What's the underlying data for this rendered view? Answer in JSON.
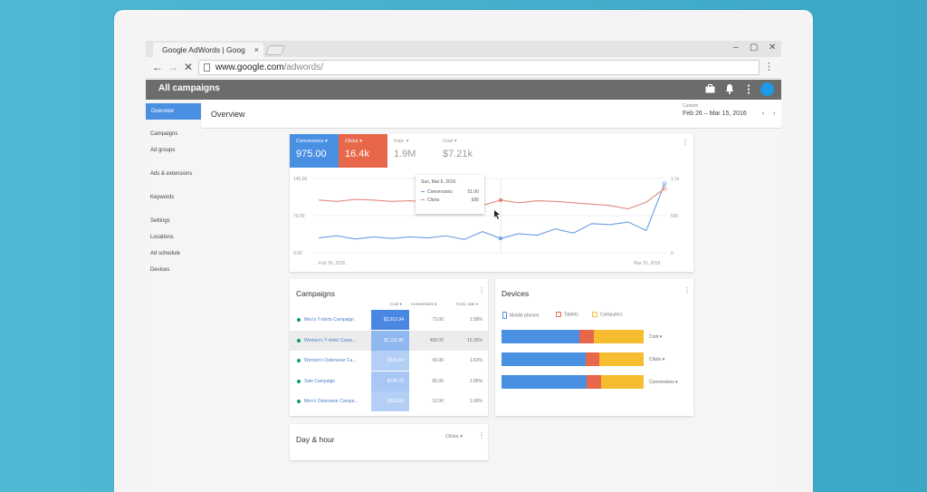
{
  "browser": {
    "tab_title": "Google AdWords | Goog",
    "tab_close": "×",
    "window_controls": [
      "–",
      "▢",
      "✕"
    ],
    "nav": {
      "back": "←",
      "forward": "→",
      "stop": "✕"
    },
    "url_host": "www.google.com",
    "url_path": "/adwords/",
    "menu": "⋮"
  },
  "appbar": {
    "title": "All campaigns",
    "icons": [
      "briefcase-icon",
      "bell-icon",
      "more-vert-icon",
      "avatar"
    ]
  },
  "sidebar": {
    "active": "Overview",
    "items": [
      "Campaigns",
      "Ad groups",
      "Ads & extensions",
      "Keywords",
      "Settings",
      "Locations",
      "Ad schedule",
      "Devices"
    ]
  },
  "overview": {
    "title": "Overview",
    "date_label": "Custom",
    "date_range": "Feb 26 – Mar 15, 2016",
    "prev": "‹",
    "next": "›"
  },
  "metrics": [
    {
      "label": "Conversions ▾",
      "value": "975.00",
      "color": "#4a90e2"
    },
    {
      "label": "Clicks ▾",
      "value": "16.4k",
      "color": "#e8674a"
    },
    {
      "label": "Impr. ▾",
      "value": "1.9M",
      "color": "#ffffff"
    },
    {
      "label": "Cost ▾",
      "value": "$7.21k",
      "color": "#ffffff"
    }
  ],
  "card_menu": "⋮",
  "chart_data": {
    "type": "line",
    "x_start_label": "Feb 26, 2016",
    "x_end_label": "Mar 15, 2016",
    "y_left_ticks": [
      "140.00",
      "70.00",
      "0.00"
    ],
    "y_right_ticks": [
      "1.1k",
      "550",
      "0"
    ],
    "ylim_left": [
      0,
      140
    ],
    "ylim_right": [
      0,
      1100
    ],
    "series": [
      {
        "name": "Conversions",
        "axis": "left",
        "color": "#6a9de0",
        "values": [
          28,
          32,
          26,
          30,
          27,
          30,
          28,
          32,
          25,
          40,
          27,
          36,
          33,
          45,
          37,
          55,
          53,
          58,
          42,
          130
        ]
      },
      {
        "name": "Clicks",
        "axis": "right",
        "color": "#e08b7e",
        "values": [
          780,
          760,
          790,
          780,
          760,
          770,
          750,
          760,
          850,
          700,
          780,
          740,
          770,
          760,
          740,
          720,
          700,
          650,
          750,
          950
        ]
      }
    ]
  },
  "tooltip": {
    "date": "Sun, Mar 6, 2016",
    "rows": [
      {
        "label": "Conversions",
        "value": "51.00",
        "color": "#6a9de0"
      },
      {
        "label": "Clicks",
        "value": "936",
        "color": "#e08b7e"
      }
    ]
  },
  "campaigns": {
    "title": "Campaigns",
    "columns": [
      "Cost ▾",
      "Conversions ▾",
      "Conv. rate ▾"
    ],
    "rows": [
      {
        "name": "Men's T-shirts Campaign",
        "cost": "$3,912.94",
        "conversions": "73.00",
        "rate": "1.58%",
        "shade": "#4a87e3"
      },
      {
        "name": "Women's T-shirts Camp...",
        "cost": "$1,211.86",
        "conversions": "468.00",
        "rate": "15.35%",
        "shade": "#8fb7f0"
      },
      {
        "name": "Women's Outerwear Ca...",
        "cost": "$516.54",
        "conversions": "43.00",
        "rate": "1.63%",
        "shade": "#b3cff6"
      },
      {
        "name": "Sale Campaign",
        "cost": "$745.79",
        "conversions": "65.00",
        "rate": "2.85%",
        "shade": "#a8c7f4"
      },
      {
        "name": "Men's Outerwear Campa...",
        "cost": "$516.54",
        "conversions": "12.00",
        "rate": "1.69%",
        "shade": "#b3cff6"
      }
    ]
  },
  "devices": {
    "title": "Devices",
    "legend": [
      {
        "label": "Mobile phones",
        "color": "#4a90e2"
      },
      {
        "label": "Tablets",
        "color": "#e8674a"
      },
      {
        "label": "Computers",
        "color": "#f6bd30"
      }
    ],
    "bars": [
      {
        "label": "Cost ▾",
        "segments": [
          0.55,
          0.1,
          0.35
        ]
      },
      {
        "label": "Clicks ▾",
        "segments": [
          0.59,
          0.1,
          0.31
        ]
      },
      {
        "label": "Conversions ▾",
        "segments": [
          0.6,
          0.1,
          0.3
        ]
      }
    ]
  },
  "dayhour": {
    "title": "Day & hour",
    "metric": "Clicks ▾"
  }
}
